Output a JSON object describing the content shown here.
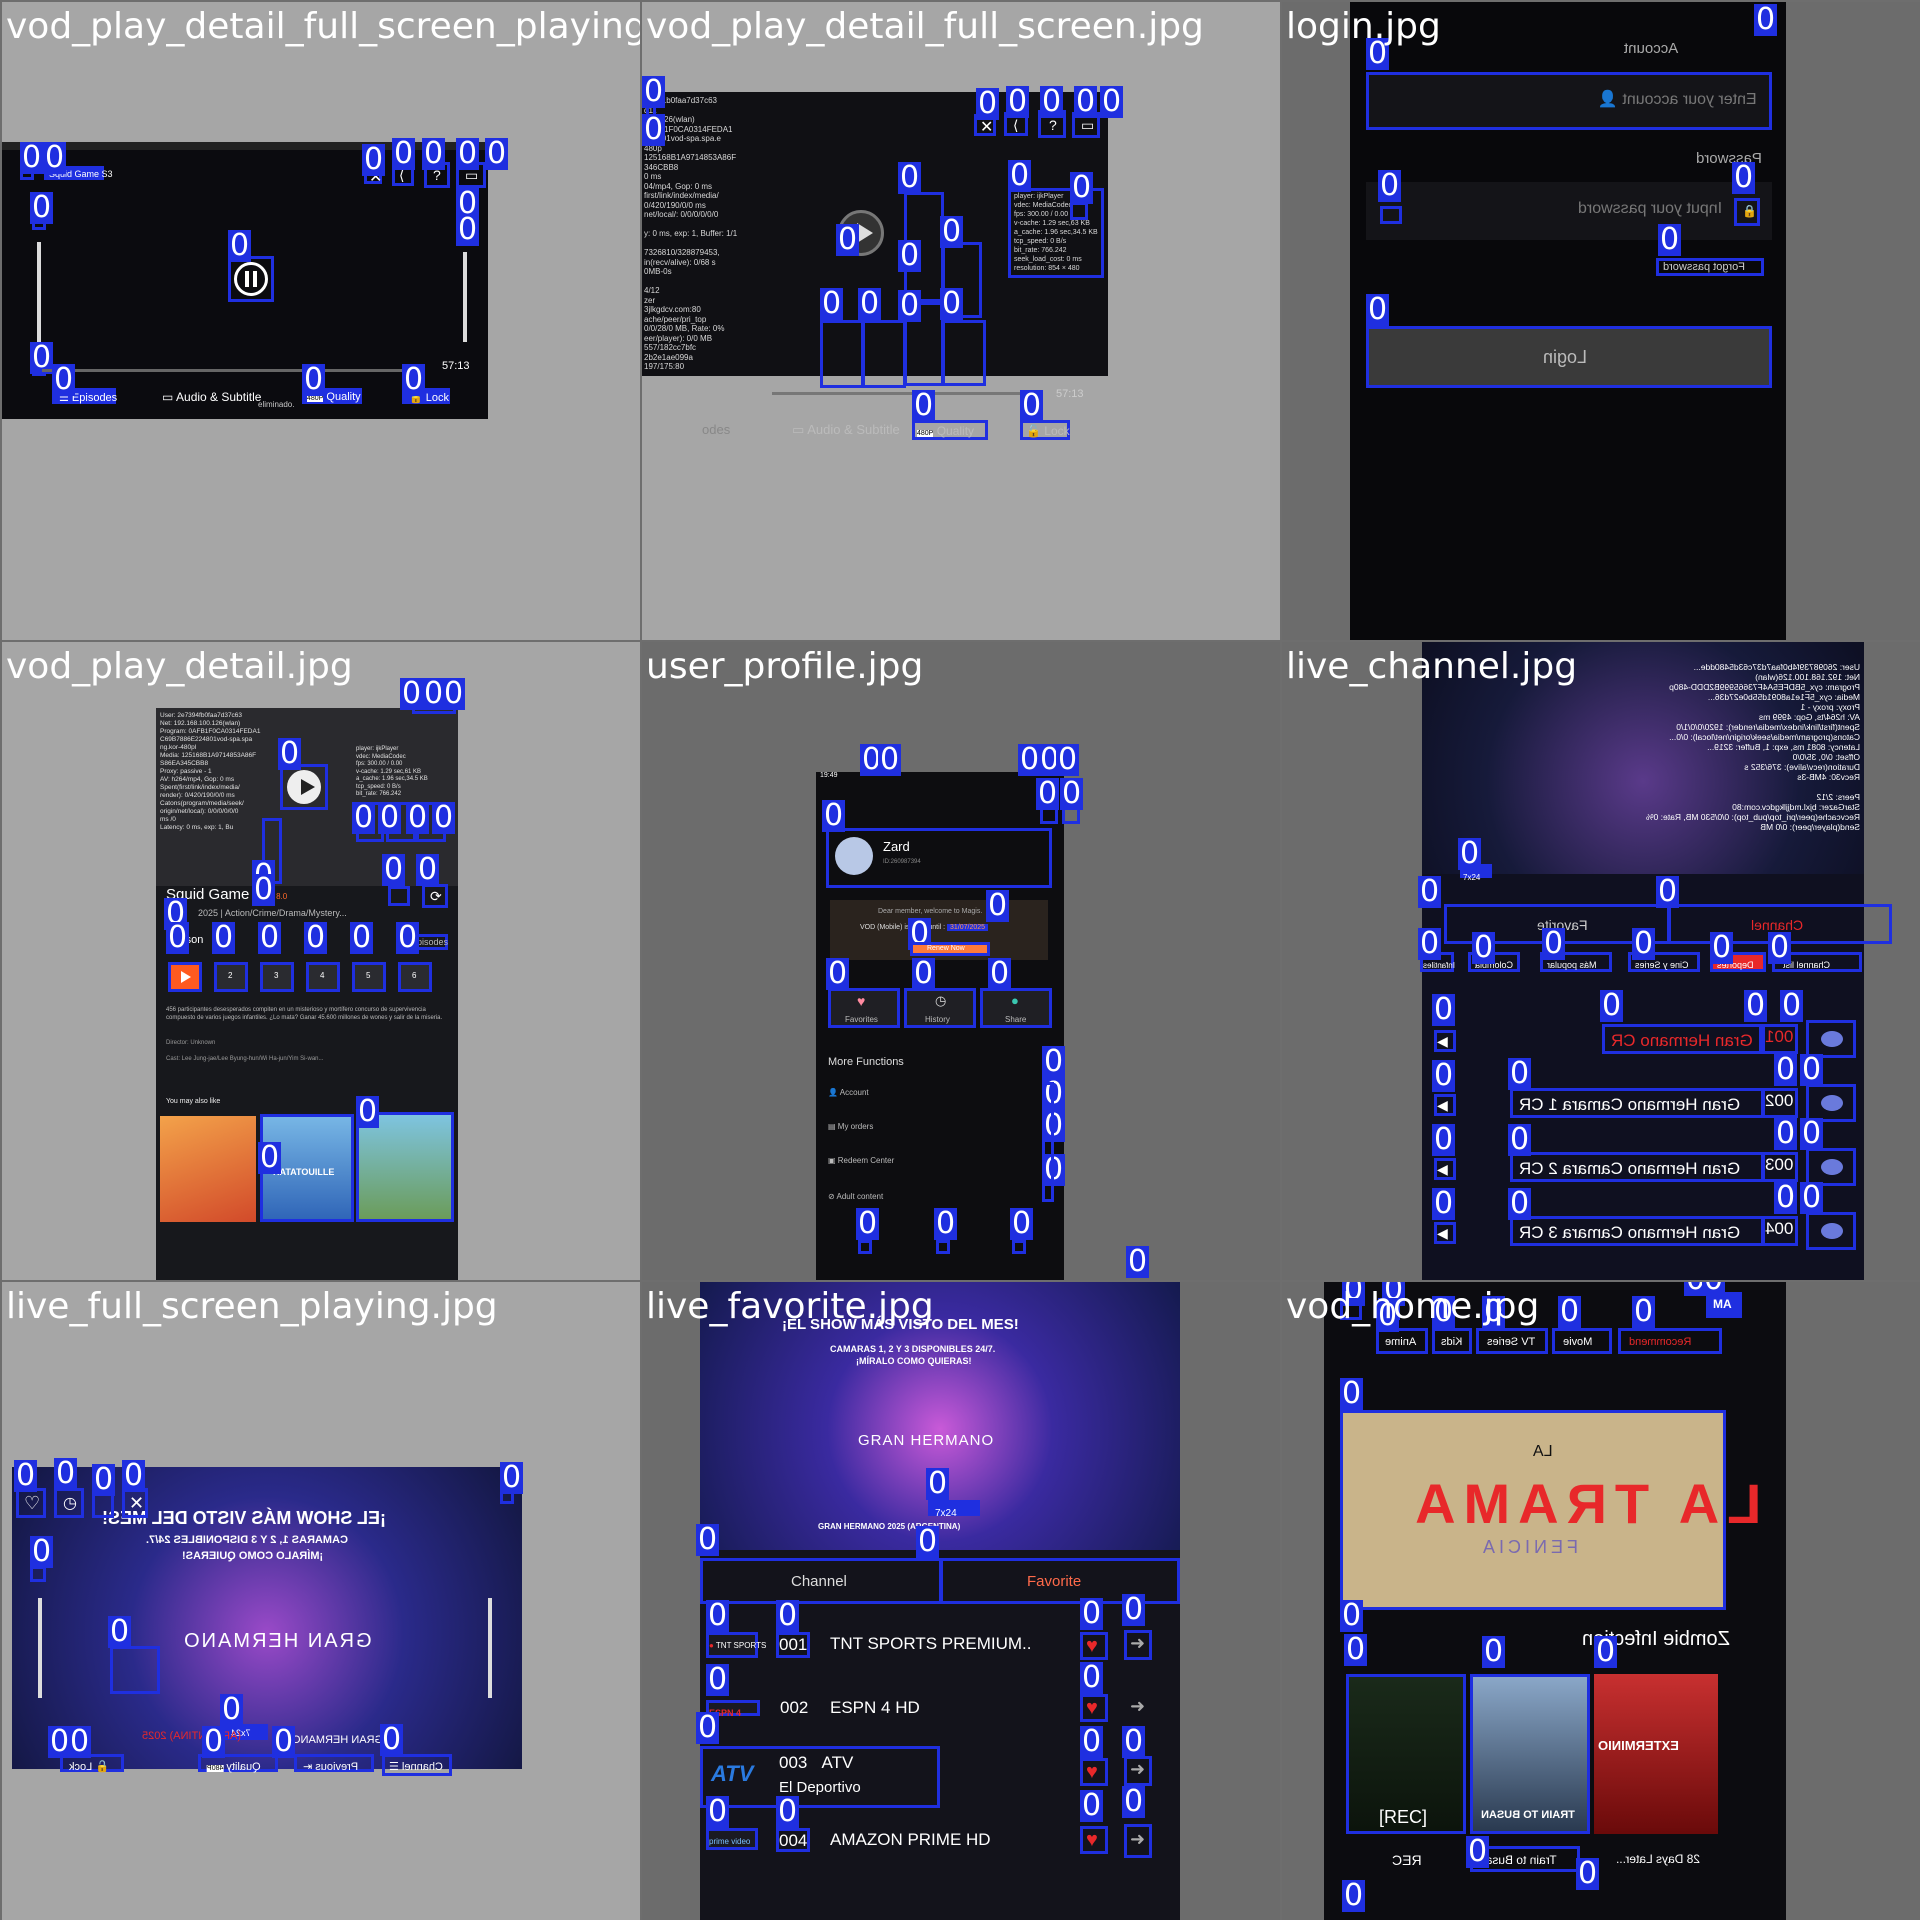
{
  "tiles": {
    "t1": {
      "label": "vod_play_detail_full_screen_playing.jpg",
      "title_tag": "Squid Game S3",
      "episodes": "Episodes",
      "audio": "Audio & Subtitle",
      "quality_badge": "480P",
      "quality": "Quality",
      "lock": "Lock",
      "duration": "57:13",
      "bottom_note": "eliminado."
    },
    "t2": {
      "label": "vod_play_detail_full_screen.jpg",
      "debug_left": "73941b0faa7d37c63\nd11\n100.126(wlan)\n0AFB1F0CA0314FEDA1\n224801vod-spa.spa.e\n480p\n125168B1A9714853A86F\n346CBB8\n0 ms\n04/mp4, Gop: 0 ms\nfirst/link/index/media/\n0/420/190/0/0 ms\nnet/local/: 0/0/0/0/0/0\n\ny: 0 ms, exp: 1, Buffer: 1/1\n\n7326810/328879453,\nin(recv/alive): 0/68 s\n0MB-0s\n\n4/12\nzer\n3jlkgdcv.com:80\nache/peer/pri_top\n0/0/28/0 MB, Rate: 0%\neer/player): 0/0 MB\n557/182cc7bfc\n2b2e1ae099a\n197/175:80",
      "debug_right": "player: ijkPlayer\nvdec: MediaCodec\nfps: 300.00 / 0.00\nv-cache: 1.29 sec,63 KB\na_cache: 1.96 sec,34.5 KB\ntcp_speed: 0 B/s\nbit_rate: 766.242\nseek_load_cost: 0 ms\nresolution: 854 × 480",
      "audio": "Audio & Subtitle",
      "quality_badge": "480P",
      "quality": "Quality",
      "lock": "Lock",
      "duration": "57:13",
      "episodes_partial": "odes"
    },
    "t3": {
      "label": "login.jpg",
      "account_label": "Account",
      "account_placeholder": "Enter your account",
      "password_label": "Password",
      "password_placeholder": "Input your password",
      "forgot": "Forgot password",
      "login": "Login"
    },
    "t4": {
      "label": "vod_play_detail.jpg",
      "debug_left": "User: 2e7394fb0faa7d37c63\nNet: 192.168.100.126(wlan)\nProgram: 0AFB1F0CA0314FEDA1\nC69B7886E224801vod-spa.spa\nng.kor-480pl\nMedia: 125168B1A9714853A86F\nS86EA345CBB8\nProxy: passive - 1\nAV: h264/mp4, Gop: 0 ms\nSpent(first/link/index/media/\nrender): 0/420/190/0/0 ms\nCatons(program/media/seek/\norigin/net/local): 0/0/0/0/0/0\nms /0\nLatency: 0 ms, exp: 1, Bu",
      "debug_right": "player: ijkPlayer\nvdec: MediaCodec\nfps: 300.00 / 0.00\nv-cache: 1.29 sec,61 KB\na_cache: 1.96 sec,34.5 KB\ntcp_speed: 0 B/s\nbit_rate: 766.242",
      "title": "Squid Game S3",
      "rating": "8.0",
      "meta": "2025 | Action/Crime/Drama/Mystery...",
      "season_tab": "Season",
      "episodes_tab": "Episodes",
      "episodes": [
        "1",
        "2",
        "3",
        "4",
        "5",
        "6"
      ],
      "description": "456 participantes desesperados compiten en un misterioso y mortífero concurso de supervivencia compuesto de varios juegos infantiles. ¿Lo mata? Ganar 45.600 millones de wones y salir de la miseria.",
      "director": "Director: Unknown",
      "cast": "Cast: Lee Jung-jae/Lee Byung-hun/Wi Ha-jun/Yim Si-wan...",
      "you_may_like": "You may also like",
      "poster2_title": "RATATOUILLE"
    },
    "t5": {
      "label": "user_profile.jpg",
      "status_time": "19:49",
      "username": "Zard",
      "user_id": "ID:260987394",
      "welcome": "Dear member, welcome to Magis.",
      "vod_valid": "VOD (Mobile) is Valid until :",
      "valid_date": "31/07/2025",
      "renew": "Renew Now",
      "shortcuts": [
        "Favorites",
        "History",
        "Share"
      ],
      "more_functions": "More Functions",
      "menu": [
        "Account",
        "My orders",
        "Redeem Center",
        "Adult content"
      ]
    },
    "t6": {
      "label": "live_channel.jpg",
      "debug_text": "User: 26098739f4b0faa7d37c63d5480dde...\nNet: 192.168.100.126(wlan)\nProgram: cyx_5BDFE5A4F73665999B2DDD-480p\nMedia: cyx_5F1e1a8091d55b0e27d36...\nProxy: proxy - 1\nAV: h264/ts, Gop: 4999 ms\nSpent(first/link/index/media/render): 1920/0/0/1/0\nCatons(program/media/seek/origin/net/local): 0/0...\nLatency: 8081 ms, exp: 1, Buffer: 3219...\nOffset: 0/0, 35/0/0\nDuration(recv/alive): 376/352 s\nRecv30: 4MB-3s\n\nPeers: 2/12\nStarGazer: bjxl.mdjjlkgdcv.com:80\nRecvcache(peer/pri_top/pub_top): 0/0/530 MB, Rate: 0%\nSend(player/peer): 0/0 MB",
      "tabs": [
        "Channel",
        "Favorite"
      ],
      "categories": [
        "Channel list",
        "Deportes",
        "Cine y Series",
        "Más popular",
        "Colombia",
        "Infantiles"
      ],
      "channels": [
        {
          "num": "001",
          "name": "Gran Hermano CR"
        },
        {
          "num": "002",
          "name": "Gran Hermano Camara 1 CR"
        },
        {
          "num": "003",
          "name": "Gran Hermano Camara 2 CR"
        },
        {
          "num": "004",
          "name": "Gran Hermano Camara 3 CR"
        }
      ],
      "live_badge": "7x24"
    },
    "t7": {
      "label": "live_full_screen_playing.jpg",
      "headline": "¡EL SHOW MÁS VISTO DEL MES!",
      "subline": "CAMARAS 1, 2 Y 3 DISPONIBLES 24/7.",
      "subline2": "¡MÍRALO COMO QUIERAS!",
      "logo": "GRAN HERMANO",
      "badge": "7x24",
      "controls": [
        "Lock",
        "Quality",
        "Previous",
        "Channel"
      ],
      "quality_badge": "480P",
      "year_text": "(ARGENTINA) 2025",
      "show_name": "GRAN HERMANO"
    },
    "t8": {
      "label": "live_favorite.jpg",
      "headline": "¡EL SHOW MÁS VISTO DEL MES!",
      "subline": "CAMARAS 1, 2 Y 3 DISPONIBLES 24/7.",
      "subline2": "¡MÍRALO COMO QUIERAS!",
      "logo": "GRAN HERMANO",
      "badge": "7x24",
      "show_year": "GRAN HERMANO 2025 (ARGENTINA)",
      "tabs": [
        "Channel",
        "Favorite"
      ],
      "channels": [
        {
          "num": "001",
          "name": "TNT SPORTS PREMIUM..",
          "logo": "TNT SPORTS"
        },
        {
          "num": "002",
          "name": "ESPN 4 HD",
          "logo": "ESPN 4"
        },
        {
          "num": "003",
          "name": "ATV",
          "sub": "El Deportivo",
          "logo": "ATV"
        },
        {
          "num": "004",
          "name": "AMAZON PRIME HD",
          "logo": "prime video"
        }
      ]
    },
    "t9": {
      "label": "vod_home.jpg",
      "tabs": [
        "Recommend",
        "Movie",
        "TV Series",
        "Kids",
        "Anime"
      ],
      "banner_title": "LA TRAMA",
      "banner_sub": "FENICIA",
      "section": "Zombie Infection",
      "posters": [
        "REC",
        "Train to Busan",
        "28 Days Later..."
      ],
      "poster_badges": [
        "[REC]",
        "TRAIN TO BUSAN",
        "EXTERMINIO"
      ]
    }
  },
  "colors": {
    "box": "#1f2fe0",
    "accent": "#ff6a2a",
    "red": "#e8282a"
  }
}
